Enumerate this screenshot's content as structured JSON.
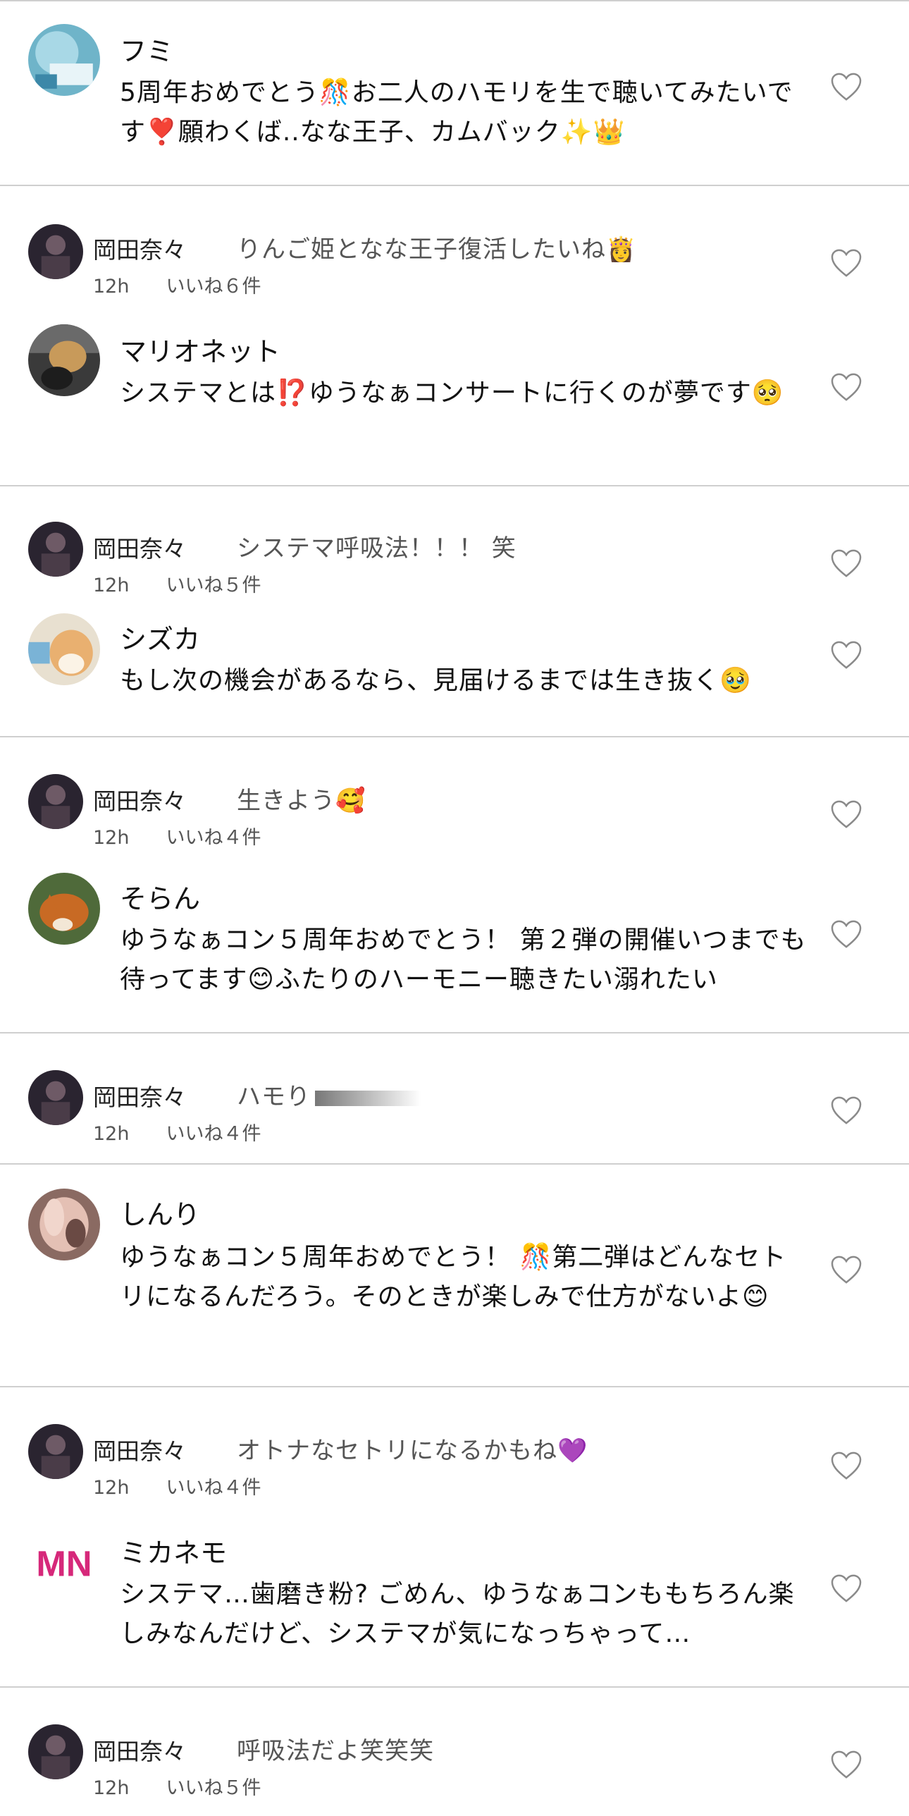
{
  "colors": {
    "divider": "#cfcfcf",
    "heart_outline": "#8a8a8a",
    "reply_text": "#555555",
    "mn_logo": "#d6287a"
  },
  "icons": {
    "like": "heart-outline-icon"
  },
  "threads": [
    {
      "comment": {
        "author": "フミ",
        "text": "5周年おめでとう🎊お二人のハモリを生で聴いてみたいです❣️願わくば..なな王子、カムバック✨👑"
      }
    },
    {
      "reply": {
        "author": "岡田奈々",
        "text": "りんご姫となな王子復活したいね👸",
        "time": "12h",
        "likes": "いいね６件"
      },
      "comment": {
        "author": "マリオネット",
        "text": "システマとは⁉️ゆうなぁコンサートに行くのが夢です🥺"
      }
    },
    {
      "reply": {
        "author": "岡田奈々",
        "text": "システマ呼吸法！！！ 笑",
        "time": "12h",
        "likes": "いいね５件"
      },
      "comment": {
        "author": "シズカ",
        "text": "もし次の機会があるなら、見届けるまでは生き抜く🥹"
      }
    },
    {
      "reply": {
        "author": "岡田奈々",
        "text": "生きよう🥰",
        "time": "12h",
        "likes": "いいね４件"
      },
      "comment": {
        "author": "そらん",
        "text": "ゆうなぁコン５周年おめでとう！ 第２弾の開催いつまでも待ってます😊ふたりのハーモニー聴きたい溺れたい"
      }
    },
    {
      "reply": {
        "author": "岡田奈々",
        "text": "ハモり",
        "time": "12h",
        "likes": "いいね４件"
      }
    },
    {
      "comment": {
        "author": "しんり",
        "text": "ゆうなぁコン５周年おめでとう！ 🎊第二弾はどんなセトリになるんだろう。そのときが楽しみで仕方がないよ😊"
      }
    },
    {
      "reply": {
        "author": "岡田奈々",
        "text": "オトナなセトリになるかもね💜",
        "time": "12h",
        "likes": "いいね４件"
      },
      "comment": {
        "author": "ミカネモ",
        "avatar_text": "MN",
        "text": "システマ…歯磨き粉? ごめん、ゆうなぁコンももちろん楽しみなんだけど、システマが気になっちゃって…"
      }
    },
    {
      "reply": {
        "author": "岡田奈々",
        "text": "呼吸法だよ笑笑笑",
        "time": "12h",
        "likes": "いいね５件"
      }
    }
  ]
}
